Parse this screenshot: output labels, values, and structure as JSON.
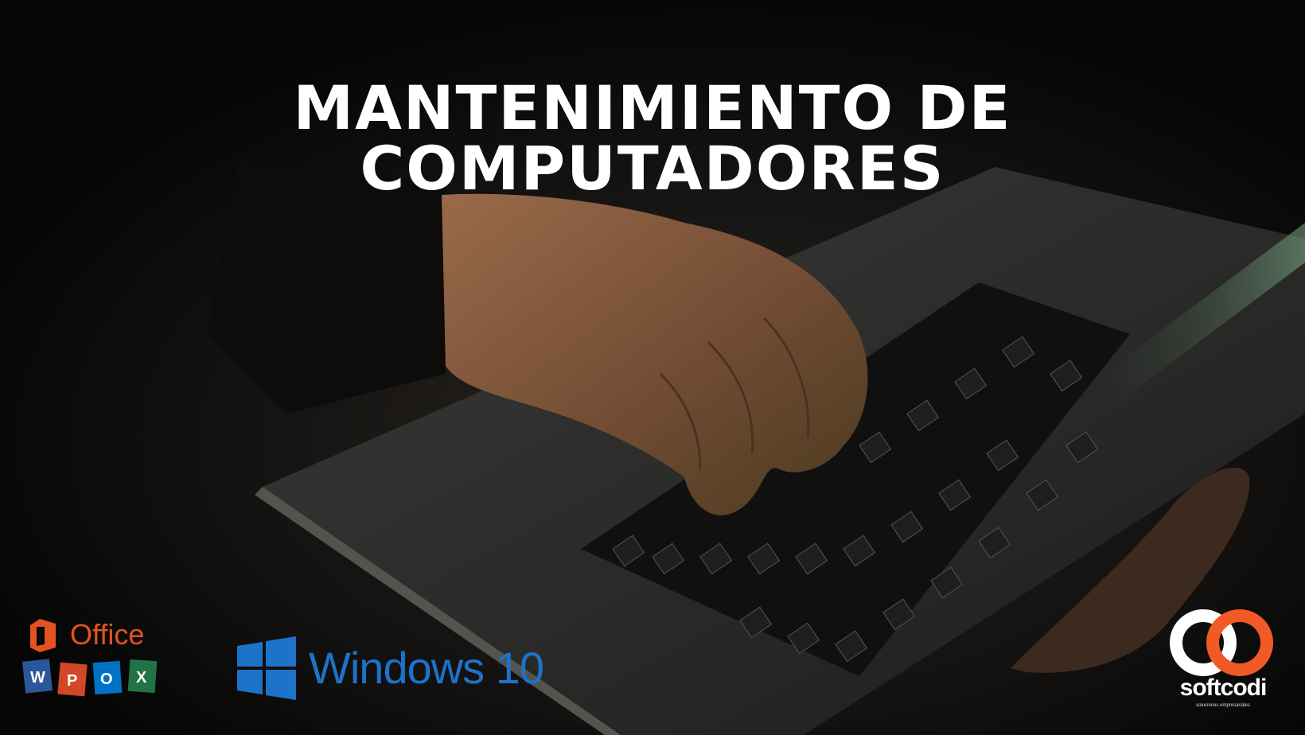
{
  "headline": "MANTENIMIENTO DE COMPUTADORES",
  "logos": {
    "office": {
      "word": "Office",
      "tiles": [
        "W",
        "P",
        "O",
        "X"
      ]
    },
    "windows": {
      "word": "Windows 10"
    },
    "softcodi": {
      "word": "softcodi",
      "tagline": "soluciones empresariales"
    }
  },
  "colors": {
    "office_orange": "#e2531f",
    "windows_blue": "#1c73c8",
    "softcodi_orange": "#f15a24",
    "text": "#ffffff"
  }
}
